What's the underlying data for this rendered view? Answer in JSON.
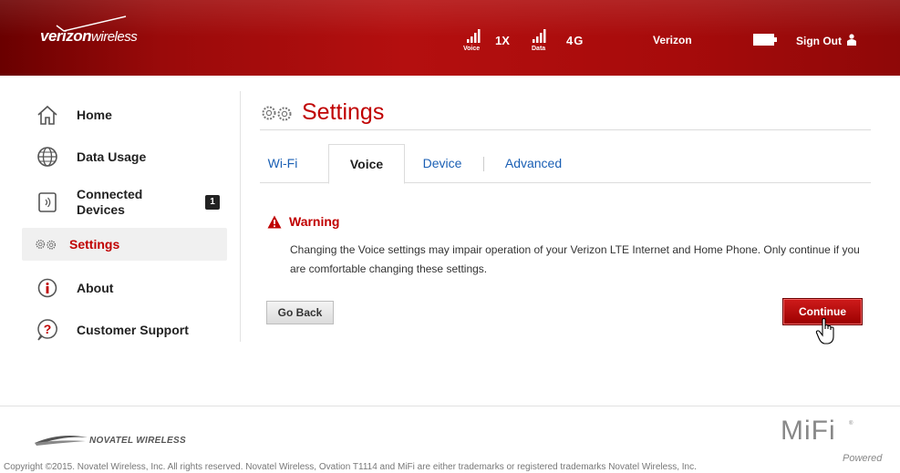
{
  "header": {
    "brand": "verizon",
    "brand_suffix": "wireless",
    "voice_label": "Voice",
    "tech_1x": "1X",
    "data_label": "Data",
    "tech_4g": "4G",
    "carrier": "Verizon",
    "sign_out": "Sign Out"
  },
  "sidebar": {
    "items": [
      {
        "label": "Home",
        "icon": "home-icon"
      },
      {
        "label": "Data Usage",
        "icon": "globe-icon"
      },
      {
        "label": "Connected Devices",
        "icon": "devices-icon",
        "badge": "1"
      },
      {
        "label": "Settings",
        "icon": "gears-icon",
        "active": true
      },
      {
        "label": "About",
        "icon": "info-icon"
      },
      {
        "label": "Customer Support",
        "icon": "help-icon"
      }
    ]
  },
  "main": {
    "title": "Settings",
    "tabs": [
      {
        "label": "Wi-Fi"
      },
      {
        "label": "Voice",
        "active": true
      },
      {
        "label": "Device"
      },
      {
        "label": "Advanced"
      }
    ],
    "warning_title": "Warning",
    "warning_message": "Changing the Voice settings may impair operation of your Verizon LTE Internet and Home Phone. Only continue if you are comfortable changing these settings.",
    "go_back": "Go Back",
    "continue": "Continue"
  },
  "footer": {
    "novatel": "NOVATEL WIRELESS",
    "mifi": "MiFi",
    "mifi_reg": "®",
    "mifi_powered": "Powered",
    "copyright": "Copyright ©2015. Novatel Wireless, Inc. All rights reserved. Novatel Wireless, Ovation T1114 and MiFi are either trademarks or registered trademarks Novatel Wireless, Inc."
  },
  "colors": {
    "accent": "#c00000",
    "link": "#1a5fb4",
    "header": "#a70b0b"
  }
}
